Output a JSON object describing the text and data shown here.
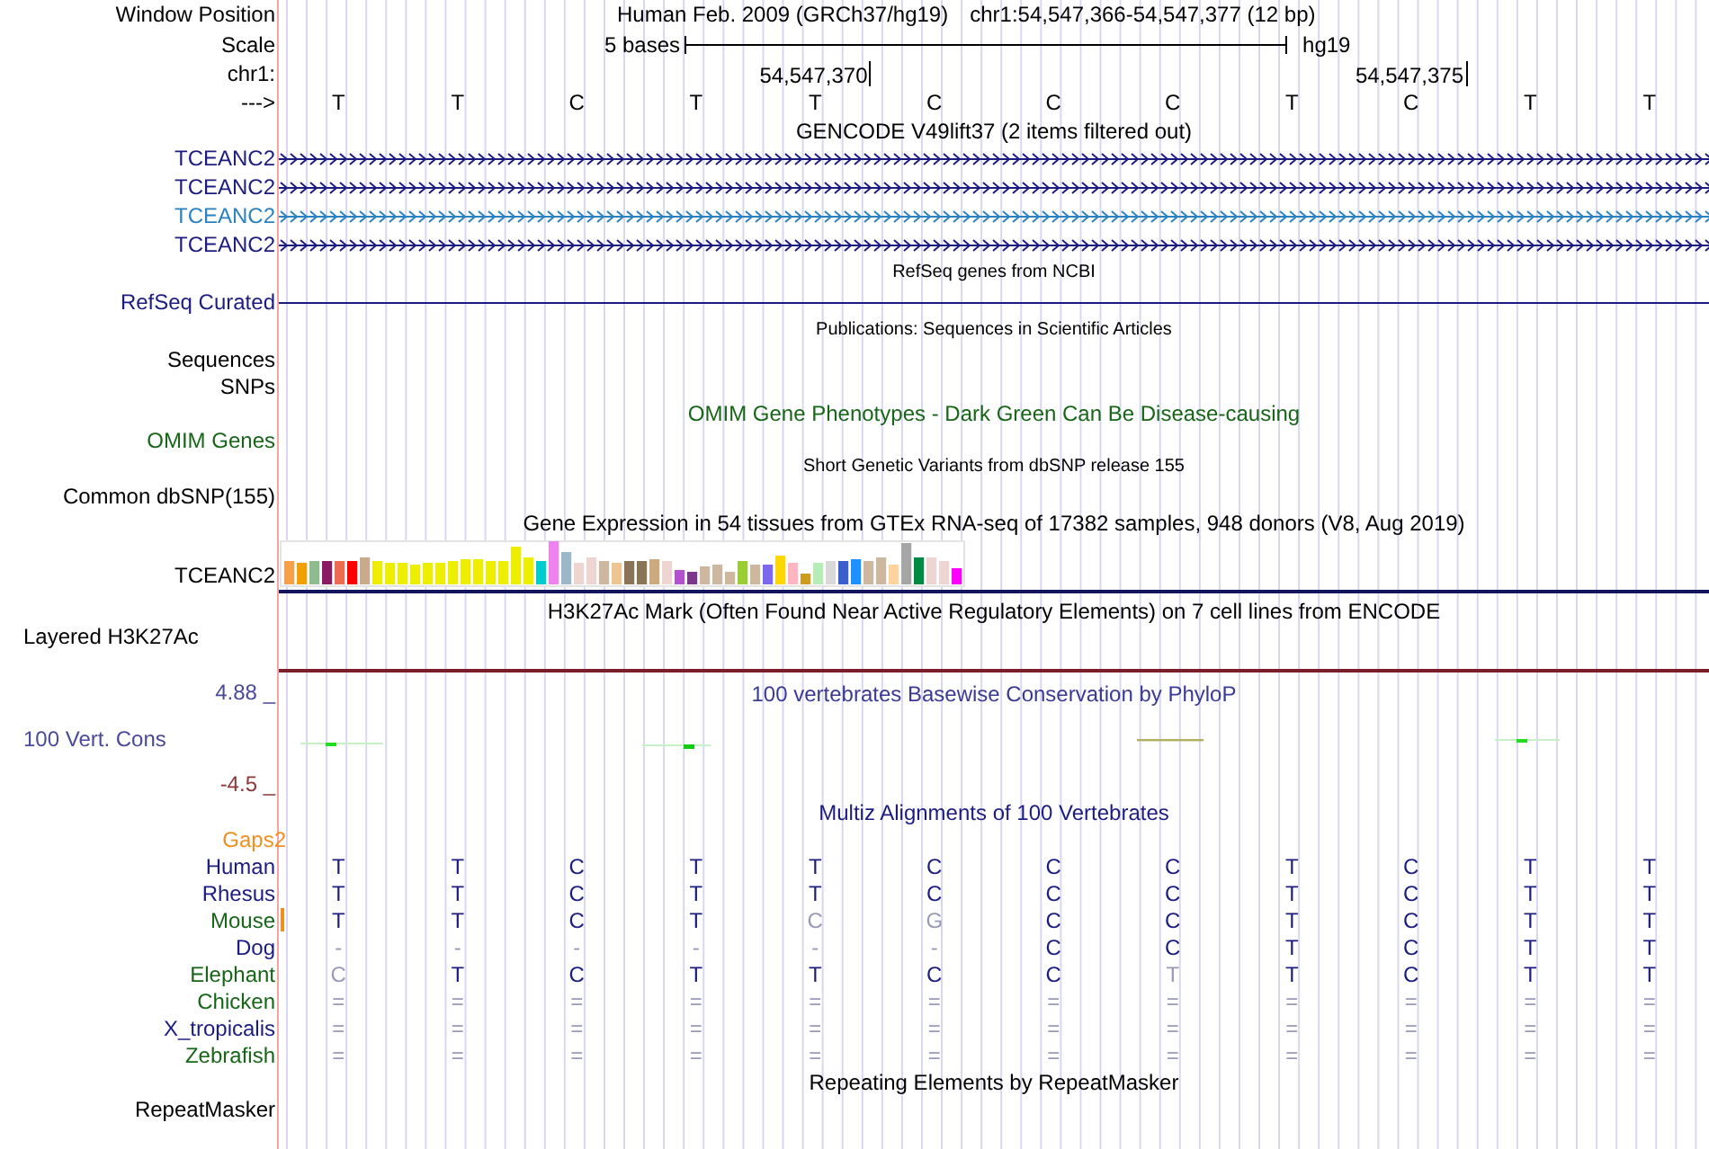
{
  "position": {
    "label": "Window Position",
    "assembly": "Human Feb. 2009 (GRCh37/hg19)",
    "range": "chr1:54,547,366-54,547,377 (12 bp)"
  },
  "scale": {
    "label": "Scale",
    "span": "5 bases",
    "db": "hg19"
  },
  "coordinates": {
    "label": "chr1:",
    "ticks": [
      "54,547,370",
      "54,547,375"
    ]
  },
  "strand": {
    "label": "--->",
    "bases": [
      "T",
      "T",
      "C",
      "T",
      "T",
      "C",
      "C",
      "C",
      "T",
      "C",
      "T",
      "T"
    ]
  },
  "tracks": [
    {
      "kind": "title",
      "text": "GENCODE V49lift37 (2 items filtered out)",
      "color": "#000000"
    },
    {
      "kind": "gene",
      "label": "TCEANC2",
      "color": "#1c1c80",
      "arrows": true
    },
    {
      "kind": "gene",
      "label": "TCEANC2",
      "color": "#1c1c80",
      "arrows": true
    },
    {
      "kind": "gene",
      "label": "TCEANC2",
      "color": "#2a82c0",
      "arrows": true
    },
    {
      "kind": "gene",
      "label": "TCEANC2",
      "color": "#1c1c80",
      "arrows": true
    },
    {
      "kind": "note",
      "text": "RefSeq genes from NCBI"
    },
    {
      "kind": "gene",
      "label": "RefSeq Curated",
      "color": "#1c1c80",
      "arrows": false
    },
    {
      "kind": "note",
      "text": "Publications: Sequences in Scientific Articles"
    },
    {
      "kind": "label",
      "label": "Sequences",
      "color": "#000000"
    },
    {
      "kind": "label",
      "label": "SNPs",
      "color": "#000000"
    },
    {
      "kind": "title",
      "text": "OMIM Gene Phenotypes - Dark Green Can Be Disease-causing",
      "color": "#176617"
    },
    {
      "kind": "label",
      "label": "OMIM Genes",
      "color": "#176617"
    },
    {
      "kind": "note",
      "text": "Short Genetic Variants from dbSNP release 155"
    },
    {
      "kind": "label",
      "label": "Common dbSNP(155)",
      "color": "#000000"
    },
    {
      "kind": "title",
      "text": "Gene Expression in 54 tissues from GTEx RNA-seq of 17382 samples, 948 donors (V8, Aug 2019)",
      "color": "#000000"
    },
    {
      "kind": "expression",
      "label": "TCEANC2"
    },
    {
      "kind": "title",
      "text": "H3K27Ac Mark (Often Found Near Active Regulatory Elements) on 7 cell lines from ENCODE",
      "color": "#000000"
    },
    {
      "kind": "signal",
      "label": "Layered H3K27Ac"
    },
    {
      "kind": "conservation",
      "max": "4.88 _",
      "label": "100 Vert. Cons",
      "min": "-4.5 _",
      "title": "100 vertebrates Basewise Conservation by PhyloP"
    },
    {
      "kind": "title",
      "text": "Multiz Alignments of 100 Vertebrates",
      "color": "#1c1c80"
    },
    {
      "kind": "label",
      "label": "Gaps2",
      "color": "#f09020"
    },
    {
      "kind": "alignment",
      "label": "Human",
      "color": "#1c1c80",
      "gap_mark": false,
      "bases": [
        "T",
        "T",
        "C",
        "T",
        "T",
        "C",
        "C",
        "C",
        "T",
        "C",
        "T",
        "T"
      ],
      "faded": [
        false,
        false,
        false,
        false,
        false,
        false,
        false,
        false,
        false,
        false,
        false,
        false
      ]
    },
    {
      "kind": "alignment",
      "label": "Rhesus",
      "color": "#1c1c80",
      "gap_mark": false,
      "bases": [
        "T",
        "T",
        "C",
        "T",
        "T",
        "C",
        "C",
        "C",
        "T",
        "C",
        "T",
        "T"
      ],
      "faded": [
        false,
        false,
        false,
        false,
        false,
        false,
        false,
        false,
        false,
        false,
        false,
        false
      ]
    },
    {
      "kind": "alignment",
      "label": "Mouse",
      "color": "#176617",
      "gap_mark": true,
      "bases": [
        "T",
        "T",
        "C",
        "T",
        "C",
        "G",
        "C",
        "C",
        "T",
        "C",
        "T",
        "T"
      ],
      "faded": [
        false,
        false,
        false,
        false,
        true,
        true,
        false,
        false,
        false,
        false,
        false,
        false
      ]
    },
    {
      "kind": "alignment",
      "label": "Dog",
      "color": "#1c1c80",
      "gap_mark": false,
      "bases": [
        "-",
        "-",
        "-",
        "-",
        "-",
        "-",
        "C",
        "C",
        "T",
        "C",
        "T",
        "T"
      ],
      "faded": [
        true,
        true,
        true,
        true,
        true,
        true,
        false,
        false,
        false,
        false,
        false,
        false
      ]
    },
    {
      "kind": "alignment",
      "label": "Elephant",
      "color": "#176617",
      "gap_mark": false,
      "bases": [
        "C",
        "T",
        "C",
        "T",
        "T",
        "C",
        "C",
        "T",
        "T",
        "C",
        "T",
        "T"
      ],
      "faded": [
        true,
        false,
        false,
        false,
        false,
        false,
        false,
        true,
        false,
        false,
        false,
        false
      ]
    },
    {
      "kind": "alignment",
      "label": "Chicken",
      "color": "#176617",
      "gap_mark": false,
      "bases": [
        "=",
        "=",
        "=",
        "=",
        "=",
        "=",
        "=",
        "=",
        "=",
        "=",
        "=",
        "="
      ],
      "faded": [
        true,
        true,
        true,
        true,
        true,
        true,
        true,
        true,
        true,
        true,
        true,
        true
      ]
    },
    {
      "kind": "alignment",
      "label": "X_tropicalis",
      "color": "#1c1c80",
      "gap_mark": false,
      "bases": [
        "=",
        "=",
        "=",
        "=",
        "=",
        "=",
        "=",
        "=",
        "=",
        "=",
        "=",
        "="
      ],
      "faded": [
        true,
        true,
        true,
        true,
        true,
        true,
        true,
        true,
        true,
        true,
        true,
        true
      ]
    },
    {
      "kind": "alignment",
      "label": "Zebrafish",
      "color": "#176617",
      "gap_mark": false,
      "bases": [
        "=",
        "=",
        "=",
        "=",
        "=",
        "=",
        "=",
        "=",
        "=",
        "=",
        "=",
        "="
      ],
      "faded": [
        true,
        true,
        true,
        true,
        true,
        true,
        true,
        true,
        true,
        true,
        true,
        true
      ]
    },
    {
      "kind": "title",
      "text": "Repeating Elements by RepeatMasker",
      "color": "#000000"
    },
    {
      "kind": "label",
      "label": "RepeatMasker",
      "color": "#000000"
    }
  ]
}
